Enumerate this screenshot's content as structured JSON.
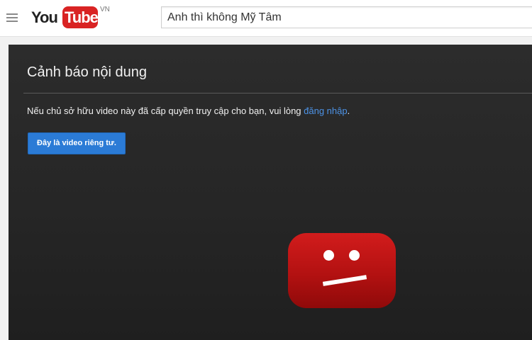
{
  "header": {
    "logo_you": "You",
    "logo_tube": "Tube",
    "logo_country": "VN",
    "search_value": "Anh thì không Mỹ Tâm"
  },
  "player": {
    "title": "Cảnh báo nội dung",
    "message_prefix": "Nếu chủ sở hữu video này đã cấp quyền truy cập cho bạn, vui lòng ",
    "login_link": "đăng nhập",
    "message_suffix": ".",
    "private_button": "Đây là video riêng tư.",
    "icon": "sad-video-icon"
  },
  "colors": {
    "accent_blue": "#2b7bd6",
    "link_blue": "#4d93e6",
    "brand_red": "#d92323",
    "player_bg": "#282828"
  }
}
